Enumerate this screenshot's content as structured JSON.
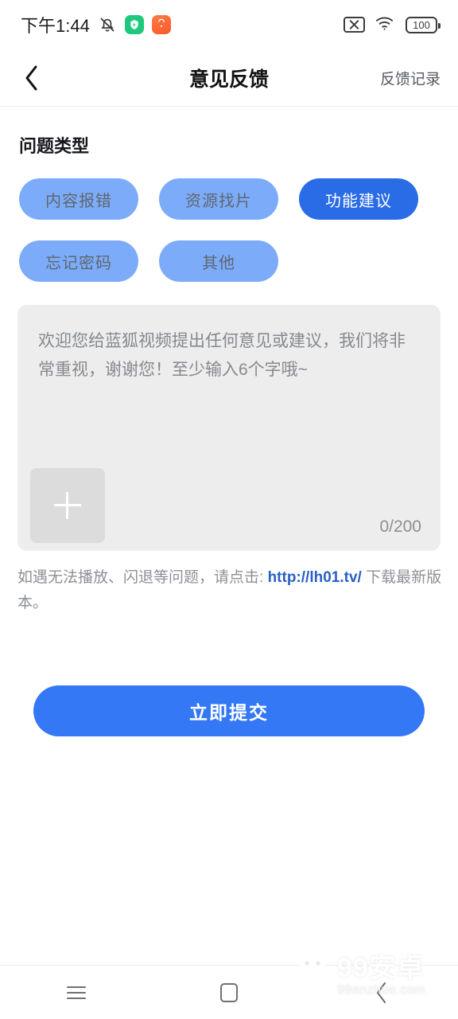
{
  "status_bar": {
    "time": "下午1:44",
    "icons_left": [
      "mute-bell-icon",
      "green-app-icon",
      "orange-app-icon"
    ],
    "icons_right": [
      "no-sim-icon",
      "wifi-icon",
      "battery-icon"
    ],
    "battery_level": "100"
  },
  "header": {
    "back_icon": "chevron-left-icon",
    "title": "意见反馈",
    "action_label": "反馈记录"
  },
  "section": {
    "title": "问题类型"
  },
  "chips": [
    {
      "label": "内容报错",
      "selected": false
    },
    {
      "label": "资源找片",
      "selected": false
    },
    {
      "label": "功能建议",
      "selected": true
    },
    {
      "label": "忘记密码",
      "selected": false
    },
    {
      "label": "其他",
      "selected": false
    }
  ],
  "feedback": {
    "placeholder": "欢迎您给蓝狐视频提出任何意见或建议，我们将非常重视，谢谢您！至少输入6个字哦~",
    "value": "",
    "counter": "0/200",
    "upload_icon": "plus-icon"
  },
  "hint": {
    "prefix": "如遇无法播放、闪退等问题，请点击: ",
    "link": "http://lh01.tv/",
    "suffix": " 下载最新版本。"
  },
  "submit": {
    "label": "立即提交"
  },
  "navbar": {
    "recents_icon": "menu-icon",
    "home_icon": "square-icon",
    "back_icon": "chevron-left-icon"
  },
  "watermark": {
    "cn": "99安卓",
    "en": "99anzhuo.com",
    "robot_icon": "android-robot-icon"
  },
  "colors": {
    "accent": "#3478f6",
    "chip_selected": "#2a6ce6",
    "chip_default": "#7cacf9",
    "panel_bg": "#ededed",
    "link": "#2a5fc4"
  }
}
